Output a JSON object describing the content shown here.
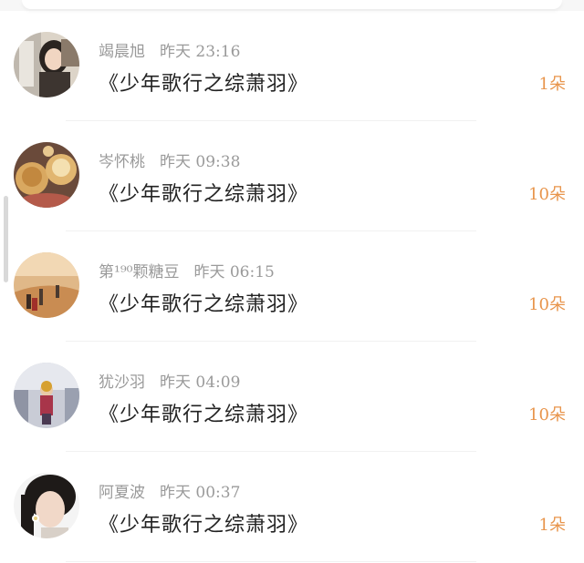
{
  "colors": {
    "accent": "#e8954c",
    "name_text": "#9a9a9a",
    "title_text": "#222222"
  },
  "items": [
    {
      "name": "竭晨旭",
      "time": "昨天 23:16",
      "title": "《少年歌行之综萧羽》",
      "count": "1朵",
      "avatar": "avatar-girl-portrait"
    },
    {
      "name": "岑怀桃",
      "time": "昨天 09:38",
      "title": "《少年歌行之综萧羽》",
      "count": "10朵",
      "avatar": "avatar-food-tarts"
    },
    {
      "name": "第¹⁹⁰颗糖豆",
      "time": "昨天 06:15",
      "title": "《少年歌行之综萧羽》",
      "count": "10朵",
      "avatar": "avatar-desert-figures"
    },
    {
      "name": "犹沙羽",
      "time": "昨天 04:09",
      "title": "《少年歌行之综萧羽》",
      "count": "10朵",
      "avatar": "avatar-figure-snow"
    },
    {
      "name": "阿夏波",
      "time": "昨天 00:37",
      "title": "《少年歌行之综萧羽》",
      "count": "1朵",
      "avatar": "avatar-girl-flower"
    }
  ]
}
